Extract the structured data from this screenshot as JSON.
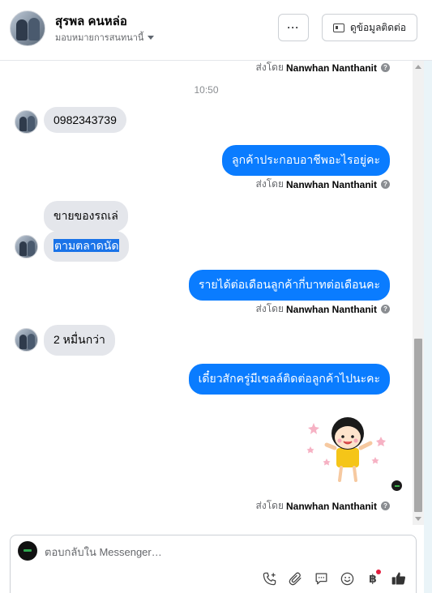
{
  "header": {
    "contact_name": "สุรพล คนหล่อ",
    "assign_label": "มอบหมายการสนทนานี้",
    "more_label": "···",
    "view_contact_label": "ดูข้อมูลติดต่อ"
  },
  "messages": {
    "sent_by_prefix": "ส่งโดย",
    "sender_name": "Nanwhan Nanthanit",
    "help_glyph": "?",
    "time": "10:50",
    "in_1": "0982343739",
    "out_1": "ลูกค้าประกอบอาชีพอะไรอยู่คะ",
    "in_2a": "ขายของรถเล่",
    "in_2b": "ตามตลาดนัด",
    "out_2": "รายได้ต่อเดือนลูกค้ากี่บาทต่อเดือนคะ",
    "in_3": "2  หมื่นกว่า",
    "out_3": "เดี๋ยวสักครู่มีเซลล์ติดต่อลูกค้าไปนะคะ"
  },
  "composer": {
    "placeholder": "ตอบกลับใน Messenger…",
    "baht_glyph": "฿"
  },
  "icons": {
    "more": "ellipsis-icon",
    "contact_card": "contact-card-icon",
    "caret": "caret-down-icon",
    "help": "help-icon",
    "call_add": "add-call-icon",
    "attach": "paperclip-icon",
    "saved_reply": "chat-bubble-icon",
    "emoji": "smiley-icon",
    "payment": "baht-icon",
    "like": "thumbs-up-icon"
  },
  "colors": {
    "outgoing_bubble": "#0a7cff",
    "incoming_bubble": "#e4e6eb",
    "selection": "#1a73e8",
    "notification": "#e41e3f"
  }
}
